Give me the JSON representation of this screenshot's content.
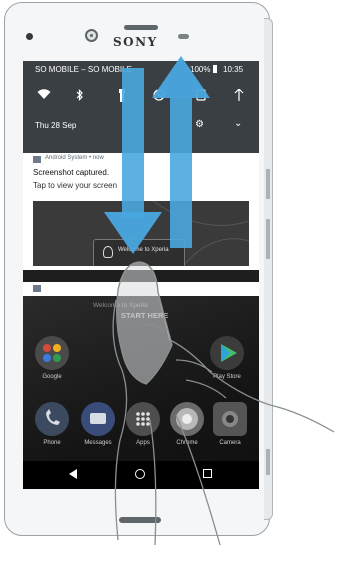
{
  "device": {
    "brand": "SONY"
  },
  "status_bar": {
    "carrier": "SO MOBILE – SO MOBILE",
    "battery": "100%",
    "time": "10:35"
  },
  "quick_settings": {
    "date": "Thu 28 Sep",
    "icons": [
      "wifi-icon",
      "bluetooth-icon",
      "flashlight-icon",
      "do-not-disturb-icon",
      "rotate-icon",
      "data-icon"
    ]
  },
  "notification": {
    "app": "Android System • now",
    "title": "Screenshot captured.",
    "body": "Tap to view your screen",
    "thumb_text": "Welcome to Xperia"
  },
  "home": {
    "lockscreen_text": "Welcome to Xperia",
    "start_text": "START HERE",
    "apps_top": [
      {
        "label": "Google",
        "icon": "google-folder-icon",
        "color": "#4a4a4a"
      },
      {
        "label": "Play Store",
        "icon": "play-store-icon",
        "color": "#3b3b3b"
      }
    ],
    "dock": [
      {
        "label": "Phone",
        "icon": "phone-icon",
        "color": "#3b4a5e"
      },
      {
        "label": "Messages",
        "icon": "messages-icon",
        "color": "#3a4d7a"
      },
      {
        "label": "Apps",
        "icon": "apps-icon",
        "color": "#4e4e4e"
      },
      {
        "label": "Chrome",
        "icon": "chrome-icon",
        "color": "#6a6a6a"
      },
      {
        "label": "Camera",
        "icon": "camera-icon",
        "color": "#555555"
      }
    ]
  },
  "gesture": {
    "description_arrows": "swipe-down-up"
  }
}
